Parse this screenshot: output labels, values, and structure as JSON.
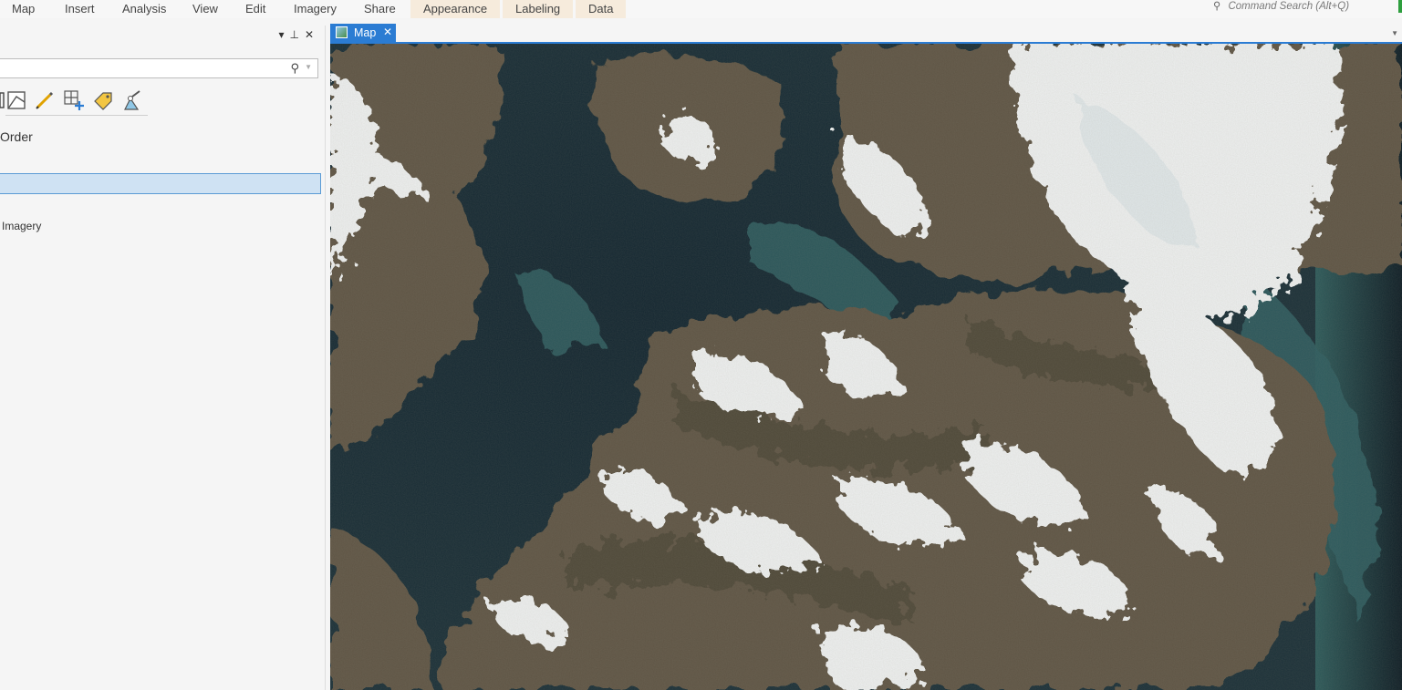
{
  "ribbon": {
    "tabs": [
      "Map",
      "Insert",
      "Analysis",
      "View",
      "Edit",
      "Imagery",
      "Share"
    ],
    "context_tabs": [
      "Appearance",
      "Labeling",
      "Data"
    ],
    "command_search": "Command Search (Alt+Q)"
  },
  "contents_pane": {
    "search": {
      "value": "",
      "placeholder": ""
    },
    "toolbar_icons": [
      "list-by-drawing-order-icon",
      "list-by-source-icon",
      "list-by-editing-icon",
      "list-by-selection-icon",
      "list-by-labeling-icon",
      "list-by-snapping-icon"
    ],
    "heading": "Order",
    "layers": [
      {
        "label": "Imagery"
      }
    ]
  },
  "map_view": {
    "tab_label": "Map",
    "close_glyph": "✕"
  },
  "colors": {
    "accent": "#2b7cd3",
    "water_deep": "#12232c",
    "water_shallow": "#2e5a5e",
    "land": "#5f5645",
    "snow": "#f2f3f3"
  }
}
